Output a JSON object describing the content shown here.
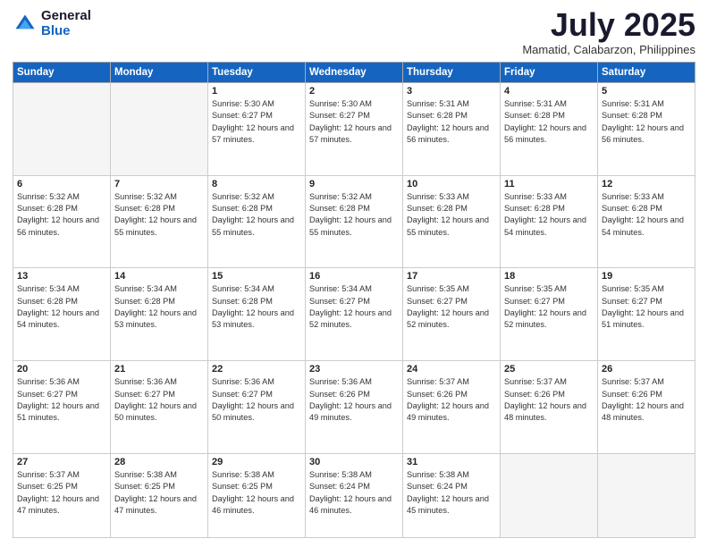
{
  "logo": {
    "general": "General",
    "blue": "Blue"
  },
  "header": {
    "month": "July 2025",
    "location": "Mamatid, Calabarzon, Philippines"
  },
  "weekdays": [
    "Sunday",
    "Monday",
    "Tuesday",
    "Wednesday",
    "Thursday",
    "Friday",
    "Saturday"
  ],
  "weeks": [
    [
      {
        "day": null,
        "sunrise": null,
        "sunset": null,
        "daylight": null
      },
      {
        "day": null,
        "sunrise": null,
        "sunset": null,
        "daylight": null
      },
      {
        "day": "1",
        "sunrise": "Sunrise: 5:30 AM",
        "sunset": "Sunset: 6:27 PM",
        "daylight": "Daylight: 12 hours and 57 minutes."
      },
      {
        "day": "2",
        "sunrise": "Sunrise: 5:30 AM",
        "sunset": "Sunset: 6:27 PM",
        "daylight": "Daylight: 12 hours and 57 minutes."
      },
      {
        "day": "3",
        "sunrise": "Sunrise: 5:31 AM",
        "sunset": "Sunset: 6:28 PM",
        "daylight": "Daylight: 12 hours and 56 minutes."
      },
      {
        "day": "4",
        "sunrise": "Sunrise: 5:31 AM",
        "sunset": "Sunset: 6:28 PM",
        "daylight": "Daylight: 12 hours and 56 minutes."
      },
      {
        "day": "5",
        "sunrise": "Sunrise: 5:31 AM",
        "sunset": "Sunset: 6:28 PM",
        "daylight": "Daylight: 12 hours and 56 minutes."
      }
    ],
    [
      {
        "day": "6",
        "sunrise": "Sunrise: 5:32 AM",
        "sunset": "Sunset: 6:28 PM",
        "daylight": "Daylight: 12 hours and 56 minutes."
      },
      {
        "day": "7",
        "sunrise": "Sunrise: 5:32 AM",
        "sunset": "Sunset: 6:28 PM",
        "daylight": "Daylight: 12 hours and 55 minutes."
      },
      {
        "day": "8",
        "sunrise": "Sunrise: 5:32 AM",
        "sunset": "Sunset: 6:28 PM",
        "daylight": "Daylight: 12 hours and 55 minutes."
      },
      {
        "day": "9",
        "sunrise": "Sunrise: 5:32 AM",
        "sunset": "Sunset: 6:28 PM",
        "daylight": "Daylight: 12 hours and 55 minutes."
      },
      {
        "day": "10",
        "sunrise": "Sunrise: 5:33 AM",
        "sunset": "Sunset: 6:28 PM",
        "daylight": "Daylight: 12 hours and 55 minutes."
      },
      {
        "day": "11",
        "sunrise": "Sunrise: 5:33 AM",
        "sunset": "Sunset: 6:28 PM",
        "daylight": "Daylight: 12 hours and 54 minutes."
      },
      {
        "day": "12",
        "sunrise": "Sunrise: 5:33 AM",
        "sunset": "Sunset: 6:28 PM",
        "daylight": "Daylight: 12 hours and 54 minutes."
      }
    ],
    [
      {
        "day": "13",
        "sunrise": "Sunrise: 5:34 AM",
        "sunset": "Sunset: 6:28 PM",
        "daylight": "Daylight: 12 hours and 54 minutes."
      },
      {
        "day": "14",
        "sunrise": "Sunrise: 5:34 AM",
        "sunset": "Sunset: 6:28 PM",
        "daylight": "Daylight: 12 hours and 53 minutes."
      },
      {
        "day": "15",
        "sunrise": "Sunrise: 5:34 AM",
        "sunset": "Sunset: 6:28 PM",
        "daylight": "Daylight: 12 hours and 53 minutes."
      },
      {
        "day": "16",
        "sunrise": "Sunrise: 5:34 AM",
        "sunset": "Sunset: 6:27 PM",
        "daylight": "Daylight: 12 hours and 52 minutes."
      },
      {
        "day": "17",
        "sunrise": "Sunrise: 5:35 AM",
        "sunset": "Sunset: 6:27 PM",
        "daylight": "Daylight: 12 hours and 52 minutes."
      },
      {
        "day": "18",
        "sunrise": "Sunrise: 5:35 AM",
        "sunset": "Sunset: 6:27 PM",
        "daylight": "Daylight: 12 hours and 52 minutes."
      },
      {
        "day": "19",
        "sunrise": "Sunrise: 5:35 AM",
        "sunset": "Sunset: 6:27 PM",
        "daylight": "Daylight: 12 hours and 51 minutes."
      }
    ],
    [
      {
        "day": "20",
        "sunrise": "Sunrise: 5:36 AM",
        "sunset": "Sunset: 6:27 PM",
        "daylight": "Daylight: 12 hours and 51 minutes."
      },
      {
        "day": "21",
        "sunrise": "Sunrise: 5:36 AM",
        "sunset": "Sunset: 6:27 PM",
        "daylight": "Daylight: 12 hours and 50 minutes."
      },
      {
        "day": "22",
        "sunrise": "Sunrise: 5:36 AM",
        "sunset": "Sunset: 6:27 PM",
        "daylight": "Daylight: 12 hours and 50 minutes."
      },
      {
        "day": "23",
        "sunrise": "Sunrise: 5:36 AM",
        "sunset": "Sunset: 6:26 PM",
        "daylight": "Daylight: 12 hours and 49 minutes."
      },
      {
        "day": "24",
        "sunrise": "Sunrise: 5:37 AM",
        "sunset": "Sunset: 6:26 PM",
        "daylight": "Daylight: 12 hours and 49 minutes."
      },
      {
        "day": "25",
        "sunrise": "Sunrise: 5:37 AM",
        "sunset": "Sunset: 6:26 PM",
        "daylight": "Daylight: 12 hours and 48 minutes."
      },
      {
        "day": "26",
        "sunrise": "Sunrise: 5:37 AM",
        "sunset": "Sunset: 6:26 PM",
        "daylight": "Daylight: 12 hours and 48 minutes."
      }
    ],
    [
      {
        "day": "27",
        "sunrise": "Sunrise: 5:37 AM",
        "sunset": "Sunset: 6:25 PM",
        "daylight": "Daylight: 12 hours and 47 minutes."
      },
      {
        "day": "28",
        "sunrise": "Sunrise: 5:38 AM",
        "sunset": "Sunset: 6:25 PM",
        "daylight": "Daylight: 12 hours and 47 minutes."
      },
      {
        "day": "29",
        "sunrise": "Sunrise: 5:38 AM",
        "sunset": "Sunset: 6:25 PM",
        "daylight": "Daylight: 12 hours and 46 minutes."
      },
      {
        "day": "30",
        "sunrise": "Sunrise: 5:38 AM",
        "sunset": "Sunset: 6:24 PM",
        "daylight": "Daylight: 12 hours and 46 minutes."
      },
      {
        "day": "31",
        "sunrise": "Sunrise: 5:38 AM",
        "sunset": "Sunset: 6:24 PM",
        "daylight": "Daylight: 12 hours and 45 minutes."
      },
      {
        "day": null,
        "sunrise": null,
        "sunset": null,
        "daylight": null
      },
      {
        "day": null,
        "sunrise": null,
        "sunset": null,
        "daylight": null
      }
    ]
  ]
}
